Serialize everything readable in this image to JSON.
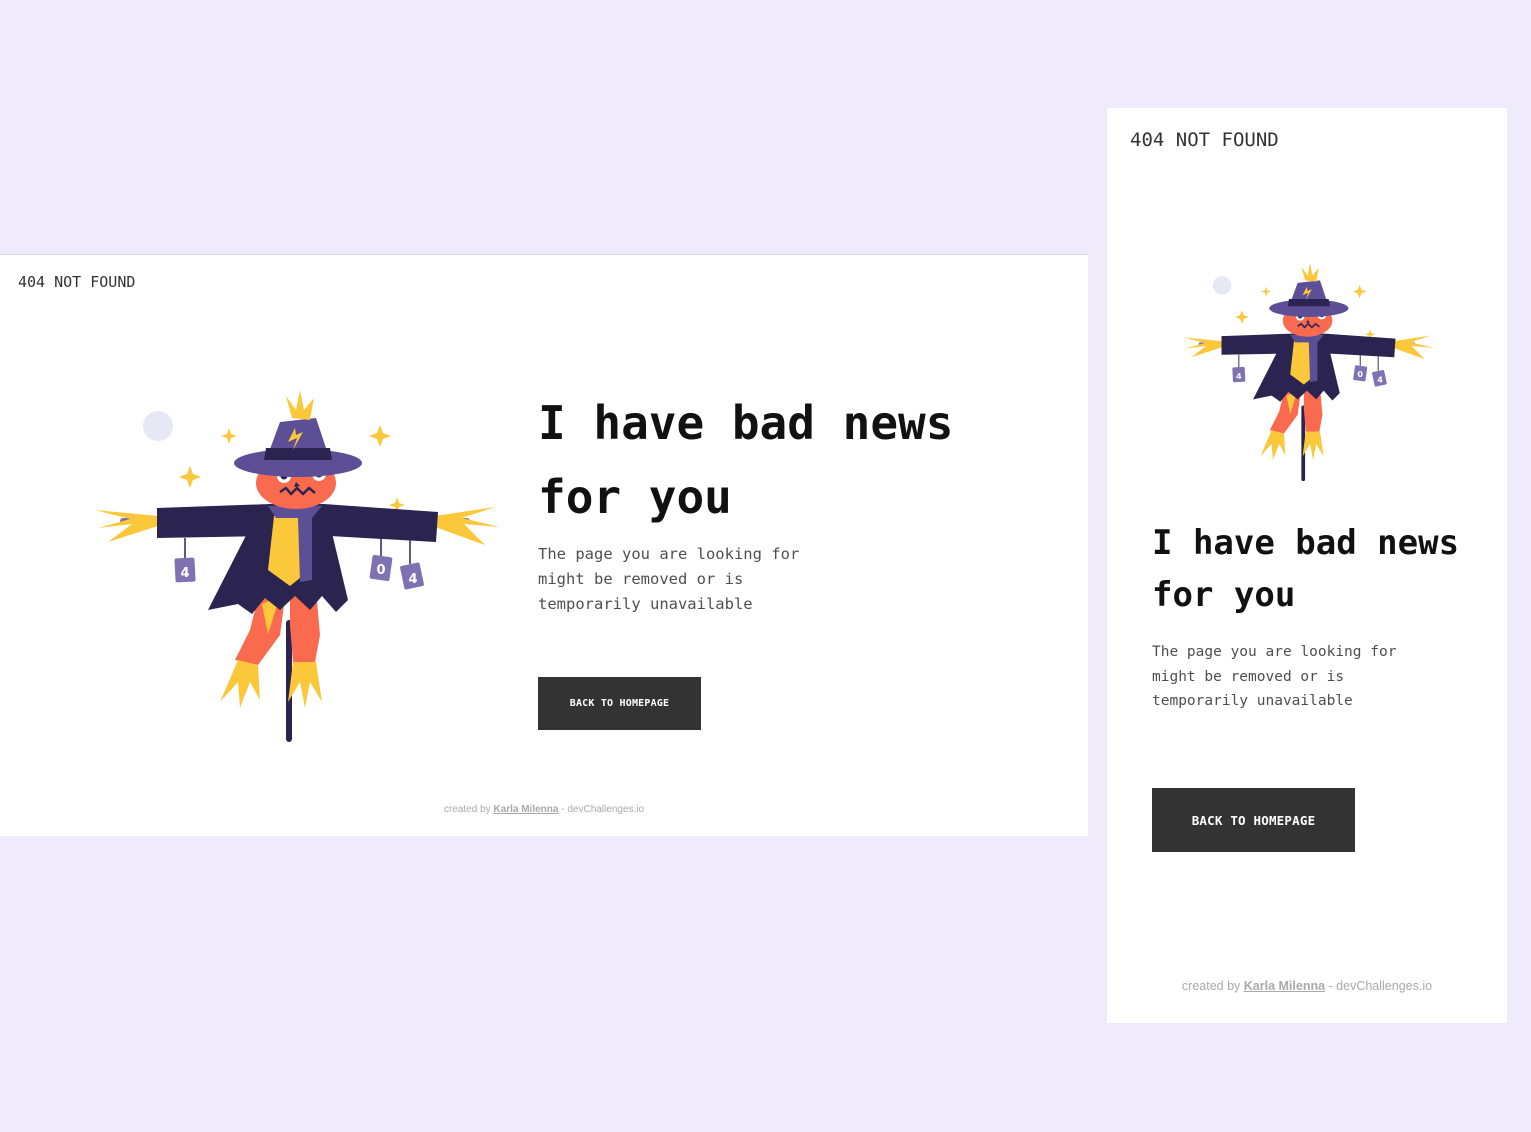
{
  "brand": "404 NOT FOUND",
  "heading": "I have bad news for you",
  "description": "The page you are looking for might be removed or is temporarily unavailable",
  "cta_label": "Back to homepage",
  "footer": {
    "prefix": "created by",
    "author": "Karla Milenna",
    "suffix": "- devChallenges.io"
  },
  "illustration": {
    "can_labels": [
      "4",
      "0",
      "4"
    ]
  },
  "colors": {
    "page_background": "#efebfa",
    "panel_background": "#ffffff",
    "text_primary": "#111111",
    "text_secondary": "#4f4f4f",
    "button_background": "#333333",
    "button_text": "#ffffff",
    "scarecrow_coat": "#2b2350",
    "scarecrow_hat": "#5c4f95",
    "scarecrow_face": "#fa6a4f",
    "straw": "#fbc73b",
    "can": "#7e72b3",
    "moon": "#e7e8f6"
  }
}
